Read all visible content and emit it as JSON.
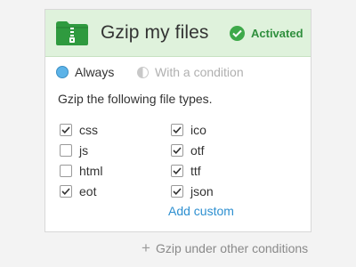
{
  "card": {
    "title": "Gzip my files",
    "status": "Activated",
    "status_color": "#3ea94a",
    "icon": "zip-folder-icon",
    "header_color": "#dff2dc"
  },
  "mode": {
    "options": [
      {
        "label": "Always",
        "selected": true
      },
      {
        "label": "With a condition",
        "selected": false
      }
    ]
  },
  "instruction": "Gzip the following file types.",
  "filetypes": [
    {
      "label": "css",
      "checked": true
    },
    {
      "label": "js",
      "checked": false
    },
    {
      "label": "html",
      "checked": false
    },
    {
      "label": "eot",
      "checked": true
    },
    {
      "label": "ico",
      "checked": true
    },
    {
      "label": "otf",
      "checked": true
    },
    {
      "label": "ttf",
      "checked": true
    },
    {
      "label": "json",
      "checked": true
    }
  ],
  "add_custom": "Add custom",
  "footer": {
    "other_conditions": "Gzip under other conditions",
    "icon": "plus-icon"
  },
  "link_color": "#2d8fd0"
}
